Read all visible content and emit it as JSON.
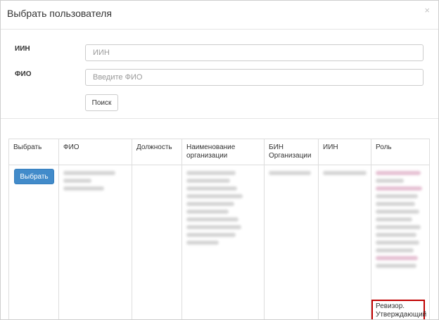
{
  "dialog": {
    "title": "Выбрать пользователя",
    "close_glyph": "×"
  },
  "form": {
    "iin_label": "ИИН",
    "iin_placeholder": "ИИН",
    "fio_label": "ФИО",
    "fio_placeholder": "Введите ФИО",
    "search_button": "Поиск"
  },
  "table": {
    "headers": {
      "select": "Выбрать",
      "fio": "ФИО",
      "position": "Должность",
      "org_name": "Наименование организации",
      "bin": "БИН Организации",
      "iin": "ИИН",
      "role": "Роль"
    },
    "rows": [
      {
        "select_button": "Выбрать",
        "visible_role": "Ревизор. Утверждающий"
      }
    ]
  },
  "colors": {
    "primary_button": "#428bca",
    "highlight_border": "#c00000"
  }
}
